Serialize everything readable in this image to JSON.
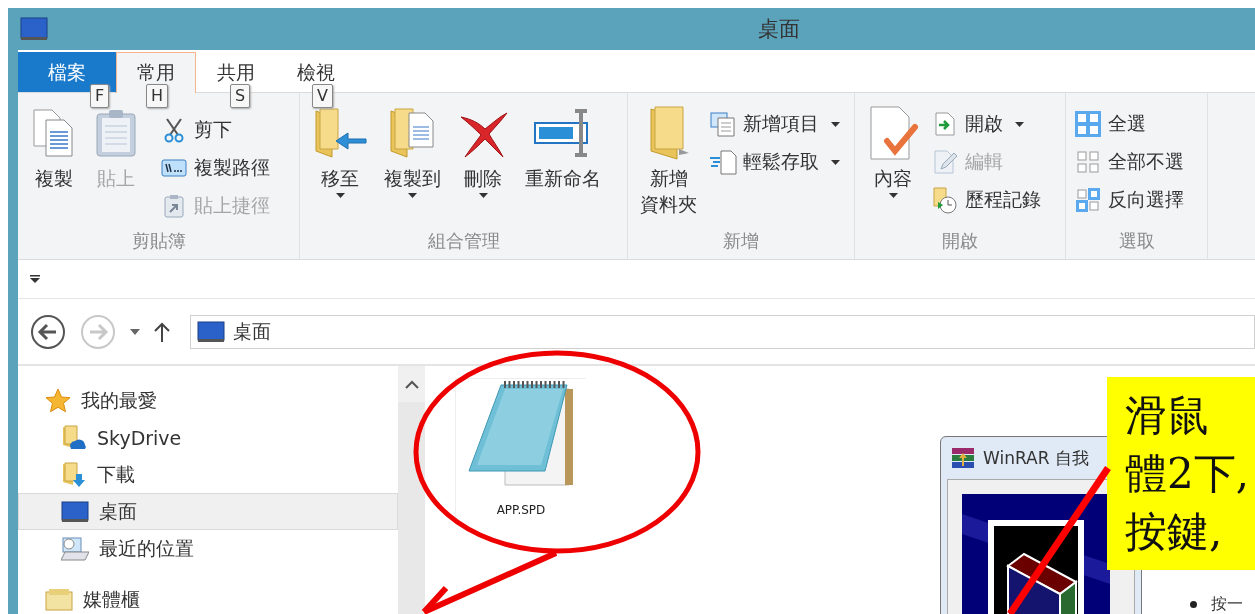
{
  "window": {
    "title": "桌面"
  },
  "tabs": [
    {
      "label": "檔案",
      "kind": "file",
      "selected": false,
      "keytip": "F"
    },
    {
      "label": "常用",
      "kind": "tab",
      "selected": true,
      "keytip": "H"
    },
    {
      "label": "共用",
      "kind": "tab",
      "selected": false,
      "keytip": "S"
    },
    {
      "label": "檢視",
      "kind": "tab",
      "selected": false,
      "keytip": "V"
    }
  ],
  "ribbon": {
    "groups": [
      {
        "label": "剪貼簿",
        "large": [
          {
            "label": "複製",
            "disabled": false,
            "dropdown": false
          },
          {
            "label": "貼上",
            "disabled": true,
            "dropdown": false
          }
        ],
        "small": [
          {
            "label": "剪下",
            "disabled": false,
            "dropdown": false
          },
          {
            "label": "複製路徑",
            "disabled": false,
            "dropdown": false
          },
          {
            "label": "貼上捷徑",
            "disabled": true,
            "dropdown": false
          }
        ]
      },
      {
        "label": "組合管理",
        "large": [
          {
            "label": "移至",
            "disabled": false,
            "dropdown": true
          },
          {
            "label": "複製到",
            "disabled": false,
            "dropdown": true
          },
          {
            "label": "刪除",
            "disabled": false,
            "dropdown": true
          },
          {
            "label": "重新命名",
            "disabled": false,
            "dropdown": false
          }
        ]
      },
      {
        "label": "新增",
        "large": [
          {
            "lines": [
              "新增",
              "資料夾"
            ],
            "disabled": false,
            "dropdown": false
          }
        ],
        "small": [
          {
            "label": "新增項目",
            "disabled": false,
            "dropdown": true
          },
          {
            "label": "輕鬆存取",
            "disabled": false,
            "dropdown": true
          }
        ]
      },
      {
        "label": "開啟",
        "large": [
          {
            "label": "內容",
            "disabled": false,
            "dropdown": true
          }
        ],
        "small": [
          {
            "label": "開啟",
            "disabled": false,
            "dropdown": true
          },
          {
            "label": "編輯",
            "disabled": true,
            "dropdown": false
          },
          {
            "label": "歷程記錄",
            "disabled": false,
            "dropdown": false
          }
        ]
      },
      {
        "label": "選取",
        "small": [
          {
            "label": "全選",
            "disabled": false,
            "dropdown": false
          },
          {
            "label": "全部不選",
            "disabled": false,
            "dropdown": false
          },
          {
            "label": "反向選擇",
            "disabled": false,
            "dropdown": false
          }
        ]
      }
    ]
  },
  "address": {
    "location": "桌面",
    "back_disabled": false,
    "forward_disabled": true
  },
  "navigation": [
    {
      "label": "我的最愛",
      "selected": false,
      "children": [
        {
          "label": "SkyDrive",
          "selected": false
        },
        {
          "label": "下載",
          "selected": false
        },
        {
          "label": "桌面",
          "selected": true
        },
        {
          "label": "最近的位置",
          "selected": false
        }
      ]
    },
    {
      "label": "媒體櫃",
      "selected": false
    }
  ],
  "files": [
    {
      "name": "APP.SPD"
    }
  ],
  "dialog": {
    "title": "WinRAR 自我"
  },
  "background_text": "按一",
  "callout": {
    "lines": [
      "滑鼠",
      "體2下,",
      "按鍵,"
    ]
  }
}
